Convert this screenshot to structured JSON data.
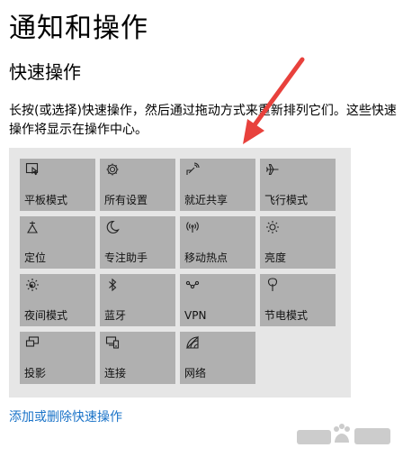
{
  "header": {
    "title": "通知和操作"
  },
  "section": {
    "title": "快速操作",
    "description": "长按(或选择)快速操作，然后通过拖动方式来重新排列它们。这些快速操作将显示在操作中心。"
  },
  "tiles": [
    {
      "label": "平板模式",
      "icon": "tablet-mode-icon"
    },
    {
      "label": "所有设置",
      "icon": "gear-icon"
    },
    {
      "label": "就近共享",
      "icon": "nearby-share-icon"
    },
    {
      "label": "飞行模式",
      "icon": "airplane-icon"
    },
    {
      "label": "定位",
      "icon": "location-icon"
    },
    {
      "label": "专注助手",
      "icon": "moon-icon"
    },
    {
      "label": "移动热点",
      "icon": "hotspot-icon"
    },
    {
      "label": "亮度",
      "icon": "brightness-icon"
    },
    {
      "label": "夜间模式",
      "icon": "night-light-icon"
    },
    {
      "label": "蓝牙",
      "icon": "bluetooth-icon"
    },
    {
      "label": "VPN",
      "icon": "vpn-icon"
    },
    {
      "label": "节电模式",
      "icon": "battery-saver-icon"
    },
    {
      "label": "投影",
      "icon": "project-icon"
    },
    {
      "label": "连接",
      "icon": "connect-icon"
    },
    {
      "label": "网络",
      "icon": "network-icon"
    }
  ],
  "footer": {
    "link_label": "添加或删除快速操作"
  },
  "colors": {
    "accent": "#1a73c8",
    "tile": "#b0b0b0",
    "panel": "#e6e6e6",
    "arrow": "#e8413c"
  }
}
